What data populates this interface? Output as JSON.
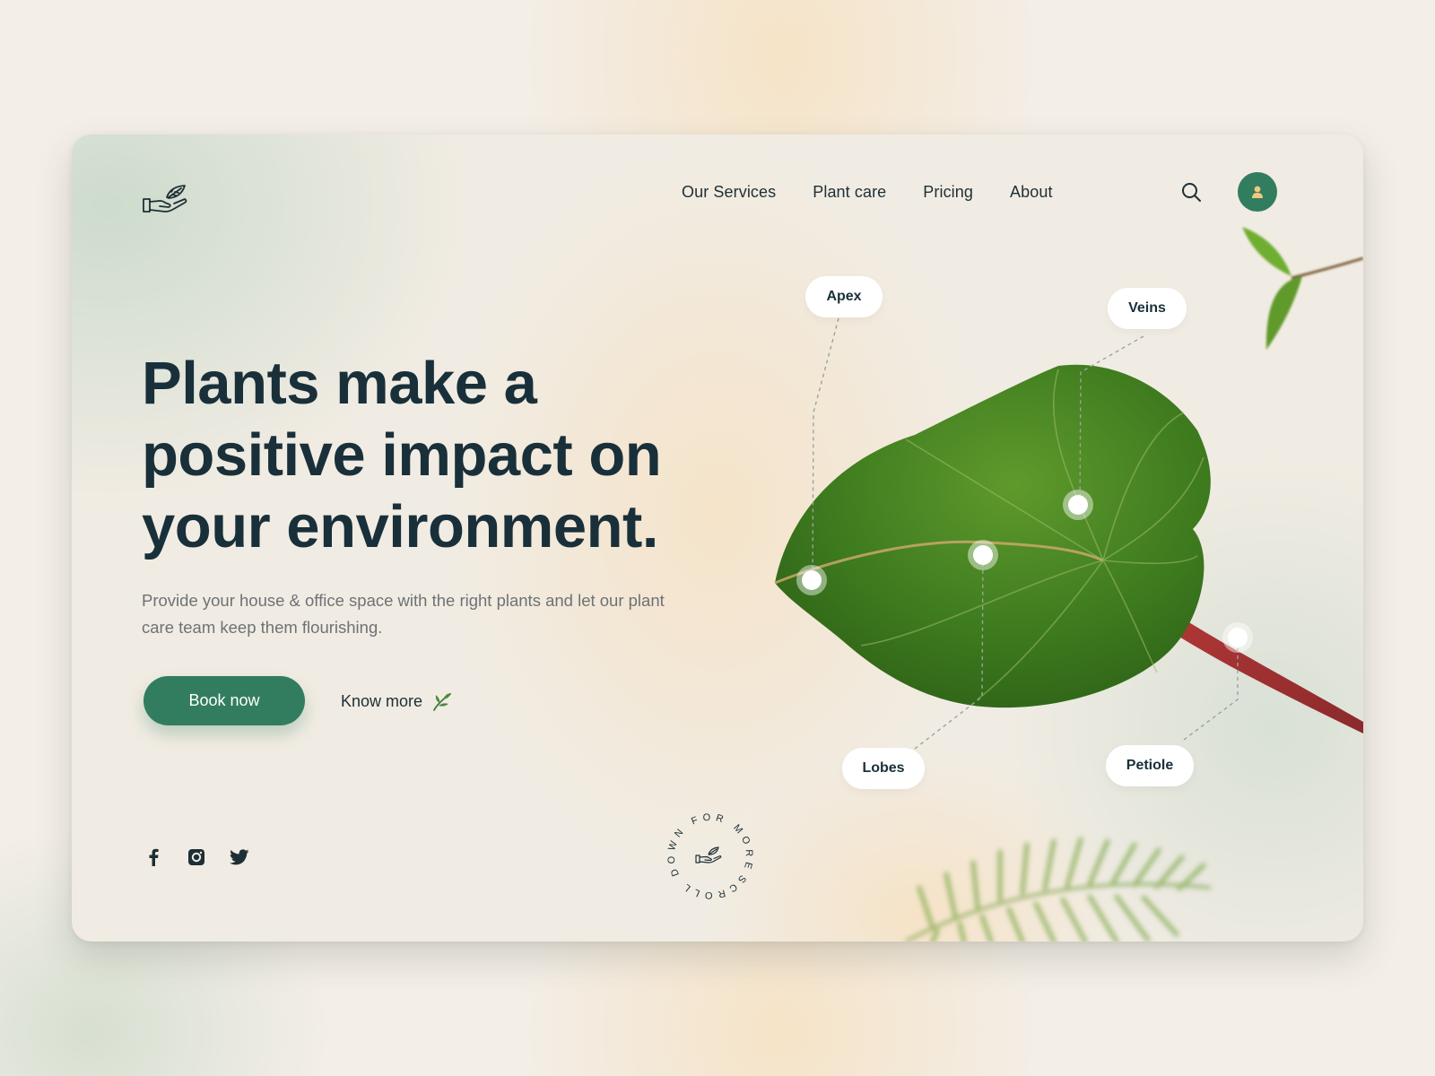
{
  "nav": {
    "items": [
      {
        "label": "Our Services"
      },
      {
        "label": "Plant care"
      },
      {
        "label": "Pricing"
      },
      {
        "label": "About"
      }
    ]
  },
  "hero": {
    "headline_line1": "Plants make a",
    "headline_line2": "positive impact on",
    "headline_line3": "your environment.",
    "subtitle": "Provide your house & office space with the right plants and let our plant care team keep them flourishing."
  },
  "buttons": {
    "book_label": "Book now",
    "know_label": "Know more"
  },
  "leaf_labels": {
    "apex": "Apex",
    "veins": "Veins",
    "lobes": "Lobes",
    "petiole": "Petiole"
  },
  "scroll_badge": {
    "text": "SCROLL DOWN FOR MORE"
  },
  "social": {
    "icons": [
      "facebook-icon",
      "instagram-icon",
      "twitter-icon"
    ]
  },
  "colors": {
    "accent": "#327d5f",
    "text_dark": "#19303a",
    "text_muted": "#6d7275"
  }
}
